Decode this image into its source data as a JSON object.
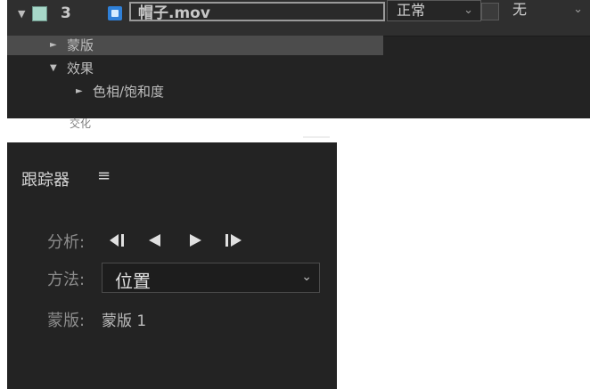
{
  "timeline": {
    "layer_number": "3",
    "layer_name": "帽子.mov",
    "blend_mode": "正常",
    "track_matte": "无",
    "sub_items": [
      {
        "label": "蒙版"
      },
      {
        "label": "效果"
      },
      {
        "label": "色相/饱和度"
      }
    ],
    "cut_text": "交化"
  },
  "tracker": {
    "title": "跟踪器",
    "analysis_label": "分析:",
    "method_label": "方法:",
    "method_value": "位置",
    "mask_label": "蒙版:",
    "mask_value": "蒙版 1"
  },
  "colors": {
    "panel_bg": "#232323",
    "label_swatch": "#a7d8c9",
    "file_icon": "#2f80d8"
  },
  "icons": {
    "layer_toggle": "triangle-down-icon",
    "file": "video-file-icon",
    "menu": "hamburger-menu-icon",
    "analyze_back_frame": "step-backward-icon",
    "analyze_back": "play-backward-icon",
    "analyze_forward": "play-forward-icon",
    "analyze_forward_frame": "step-forward-icon"
  }
}
